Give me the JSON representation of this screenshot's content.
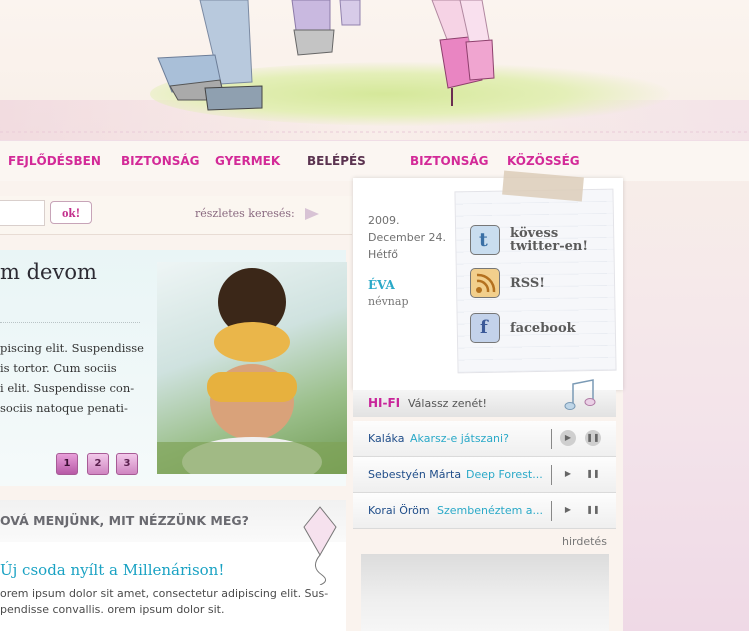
{
  "nav": {
    "items": [
      {
        "label": "FEJLŐDÉSBEN"
      },
      {
        "label": "BIZTONSÁG"
      },
      {
        "label": "GYERMEK"
      },
      {
        "label": "BELÉPÉS"
      },
      {
        "label": "BIZTONSÁG"
      },
      {
        "label": "KÖZÖSSÉG"
      }
    ]
  },
  "search": {
    "value": "",
    "ok_label": "ok!",
    "advanced_label": "részletes keresés:"
  },
  "feature": {
    "title": "m devom",
    "lines": [
      "piscing elit. Suspendisse",
      "is tortor. Cum sociis",
      "i elit. Suspendisse con-",
      "sociis natoque penati-"
    ],
    "pages": [
      "1",
      "2",
      "3"
    ],
    "active_page": "1"
  },
  "events": {
    "header": "OVÁ MENJÜNK, MIT NÉZZÜNK MEG?",
    "item_title": "Új csoda nyílt a Millenárison!",
    "item_lines": [
      "orem ipsum dolor sit amet, consectetur adipiscing elit. Sus-",
      "pendisse convallis. orem ipsum dolor sit."
    ]
  },
  "sidebar": {
    "date": {
      "year": "2009.",
      "day": "December 24.",
      "weekday": "Hétfő"
    },
    "nameday": {
      "name": "ÉVA",
      "label": "névnap"
    },
    "social": [
      {
        "icon": "twitter-icon",
        "label_line1": "kövess",
        "label_line2": "twitter-en!"
      },
      {
        "icon": "rss-icon",
        "label_line1": "RSS!",
        "label_line2": ""
      },
      {
        "icon": "facebook-icon",
        "label_line1": "facebook",
        "label_line2": ""
      }
    ],
    "hifi": {
      "title": "HI-FI",
      "subtitle": "Válassz zenét!",
      "tracks": [
        {
          "artist": "Kaláka",
          "song": "Akarsz-e játszani?"
        },
        {
          "artist": "Sebestyén Márta",
          "song": "Deep Forest..."
        },
        {
          "artist": "Korai Öröm",
          "song": "Szembenéztem a..."
        }
      ]
    },
    "ad_label": "hirdetés"
  },
  "colors": {
    "accent": "#d32a98",
    "link": "#2aa9c8",
    "artist": "#1f4d89"
  }
}
